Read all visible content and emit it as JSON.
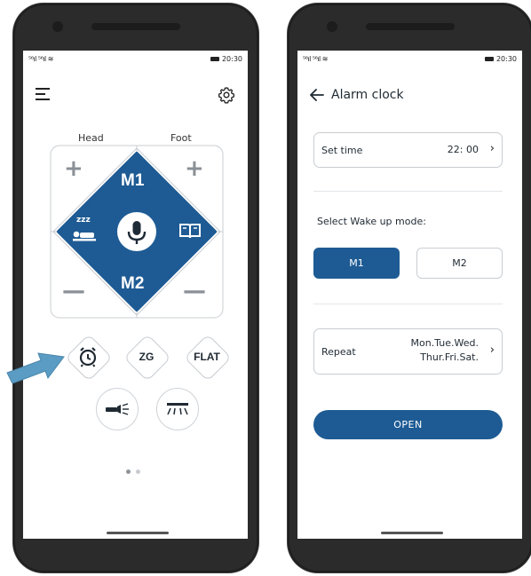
{
  "status_bar": {
    "signal": "⁵⁶ıl ⁵⁶ıl ≋",
    "time": "20:30"
  },
  "left_screen": {
    "head_label": "Head",
    "foot_label": "Foot",
    "pad": {
      "top_label": "M1",
      "bottom_label": "M2",
      "plus_symbol": "+",
      "minus_symbol": "—",
      "sleep_zzz": "zzz"
    },
    "mode_buttons": {
      "alarm_icon": "alarm-clock-icon",
      "zg_label": "ZG",
      "flat_label": "FLAT"
    },
    "bottom_buttons": {
      "flashlight_icon": "flashlight-icon",
      "underbed_light_icon": "underbed-light-icon"
    },
    "pager_count": 2,
    "pager_active": 0
  },
  "right_screen": {
    "title": "Alarm clock",
    "set_time_label": "Set time",
    "set_time_value": "22: 00",
    "wake_mode_label": "Select Wake up mode:",
    "mode_m1": "M1",
    "mode_m2": "M2",
    "selected_mode": "M1",
    "repeat_label": "Repeat",
    "repeat_value_line1": "Mon.Tue.Wed.",
    "repeat_value_line2": "Thur.Fri.Sat.",
    "open_button": "OPEN"
  },
  "colors": {
    "accent": "#1e5b94",
    "arrow": "#5b9cc4",
    "pad_border": "#c9cdd1"
  }
}
